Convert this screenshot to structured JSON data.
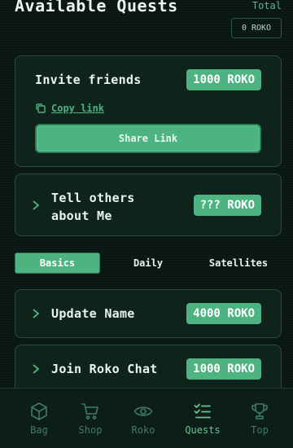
{
  "header": {
    "title": "Available Quests",
    "total_label": "Total",
    "total_value": "0 ROKO"
  },
  "quests": {
    "invite": {
      "title": "Invite friends",
      "reward": "1000 ROKO",
      "copy_link_label": "Copy link",
      "share_button_label": "Share Link"
    },
    "tell_others": {
      "title_line1": "Tell others",
      "title_line2": "about Me",
      "reward": "??? ROKO"
    },
    "update_name": {
      "title": "Update Name",
      "reward": "4000 ROKO"
    },
    "join_chat": {
      "title": "Join Roko Chat",
      "reward": "1000 ROKO"
    }
  },
  "tabs": [
    {
      "label": "Basics",
      "active": true
    },
    {
      "label": "Daily",
      "active": false
    },
    {
      "label": "Satellites",
      "active": false
    }
  ],
  "nav": [
    {
      "label": "Bag",
      "icon": "cube-icon",
      "active": false
    },
    {
      "label": "Shop",
      "icon": "cart-icon",
      "active": false
    },
    {
      "label": "Roko",
      "icon": "eye-icon",
      "active": false
    },
    {
      "label": "Quests",
      "icon": "checklist-icon",
      "active": true
    },
    {
      "label": "Top",
      "icon": "trophy-icon",
      "active": false
    }
  ],
  "colors": {
    "background": "#0b1a14",
    "accent": "#4db381",
    "nav_inactive": "#3f7d60",
    "nav_active": "#65c494"
  }
}
